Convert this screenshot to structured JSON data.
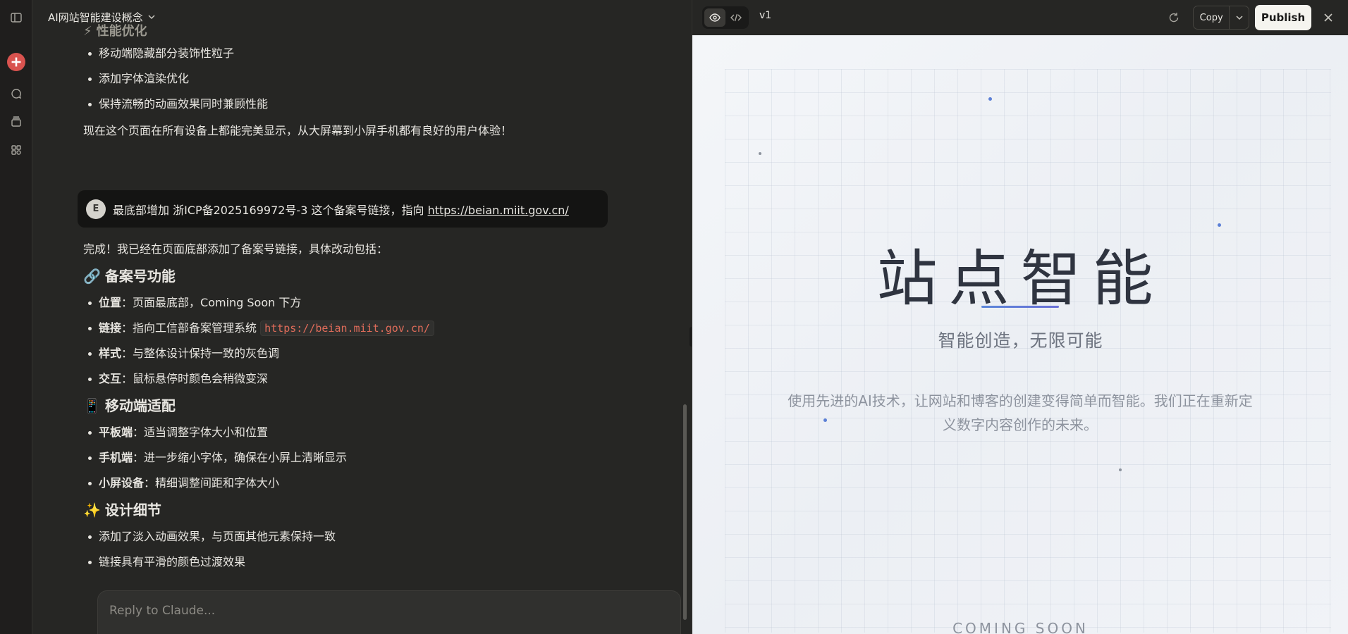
{
  "chat": {
    "title": "AI网站智能建设概念",
    "top_heading_partial": "性能优化",
    "perf_items": [
      "移动端隐藏部分装饰性粒子",
      "添加字体渲染优化",
      "保持流畅的动画效果同时兼顾性能"
    ],
    "summary": "现在这个页面在所有设备上都能完美显示，从大屏幕到小屏手机都有良好的用户体验！",
    "user_message": {
      "avatar": "E",
      "text": "最底部增加 浙ICP备2025169972号-3 这个备案号链接，指向 ",
      "link": "https://beian.miit.gov.cn/"
    },
    "reply_intro": "完成！我已经在页面底部添加了备案号链接，具体改动包括：",
    "sections": [
      {
        "heading": "备案号功能",
        "items": [
          {
            "label": "位置",
            "text": "：页面最底部，Coming Soon 下方",
            "code": ""
          },
          {
            "label": "链接",
            "text": "：指向工信部备案管理系统 ",
            "code": "https://beian.miit.gov.cn/"
          },
          {
            "label": "样式",
            "text": "：与整体设计保持一致的灰色调",
            "code": ""
          },
          {
            "label": "交互",
            "text": "：鼠标悬停时颜色会稍微变深",
            "code": ""
          }
        ]
      },
      {
        "heading": "移动端适配",
        "items": [
          {
            "label": "平板端",
            "text": "：适当调整字体大小和位置",
            "code": ""
          },
          {
            "label": "手机端",
            "text": "：进一步缩小字体，确保在小屏上清晰显示",
            "code": ""
          },
          {
            "label": "小屏设备",
            "text": "：精细调整间距和字体大小",
            "code": ""
          }
        ]
      },
      {
        "heading": "设计细节",
        "items": [
          {
            "label": "",
            "text": "添加了淡入动画效果，与页面其他元素保持一致",
            "code": ""
          },
          {
            "label": "",
            "text": "链接具有平滑的颜色过渡效果",
            "code": ""
          }
        ]
      }
    ],
    "reply_placeholder": "Reply to Claude..."
  },
  "artifact": {
    "version": "v1",
    "copy_label": "Copy",
    "publish_label": "Publish",
    "preview": {
      "title": "站点智能",
      "subtitle": "智能创造，无限可能",
      "description": "使用先进的AI技术，让网站和博客的创建变得简单而智能。我们正在重新定义数字内容创作的未来。",
      "coming_soon": "COMING SOON"
    }
  },
  "colors": {
    "accent_red": "#d9534f",
    "code_red": "#e06c5a",
    "hero_line": "#5b86d9",
    "background": "#262624"
  }
}
